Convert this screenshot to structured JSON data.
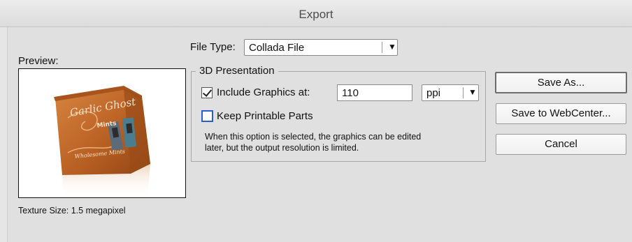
{
  "window": {
    "title": "Export"
  },
  "preview": {
    "label": "Preview:",
    "texture_size": "Texture Size: 1.5 megapixel"
  },
  "file_type": {
    "label": "File Type:",
    "value": "Collada File"
  },
  "presentation": {
    "title": "3D Presentation",
    "include_graphics": {
      "label": "Include Graphics at:",
      "checked": true,
      "value": "110",
      "unit": "ppi"
    },
    "keep_printable": {
      "label": "Keep Printable Parts",
      "checked": false
    },
    "note_line1": "When this option is selected, the graphics can be edited",
    "note_line2": "later, but the output resolution is limited."
  },
  "buttons": {
    "save_as": "Save As...",
    "save_to_webcenter": "Save to WebCenter...",
    "cancel": "Cancel"
  },
  "package_art": {
    "brand_line1": "Garlic Ghost",
    "brand_line2": "Mints",
    "flavor": "Wholesome Mints"
  },
  "colors": {
    "package": "#c46a2a",
    "focus_ring": "#2e5cc8"
  }
}
